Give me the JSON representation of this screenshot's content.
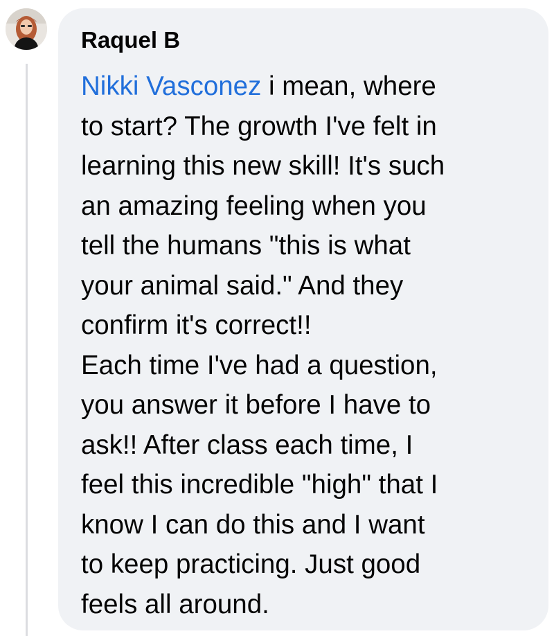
{
  "comment": {
    "author": "Raquel B",
    "mention": "Nikki Vasconez",
    "text": " i mean, where\nto start? The growth I've felt in\nlearning this new skill! It's such\nan amazing feeling when you\ntell the humans \"this is what\nyour animal said.\" And they\nconfirm it's correct!!\nEach time I've had a question,\nyou answer it before I have to\nask!! After class each time, I\nfeel this incredible \"high\" that I\nknow I can do this and I want\nto keep practicing. Just good\nfeels all around."
  },
  "colors": {
    "bubble_background": "#f0f2f5",
    "mention": "#216fdb",
    "thread_line": "#dcdde1",
    "text": "#050505"
  },
  "icons": {
    "avatar": "profile-photo"
  }
}
